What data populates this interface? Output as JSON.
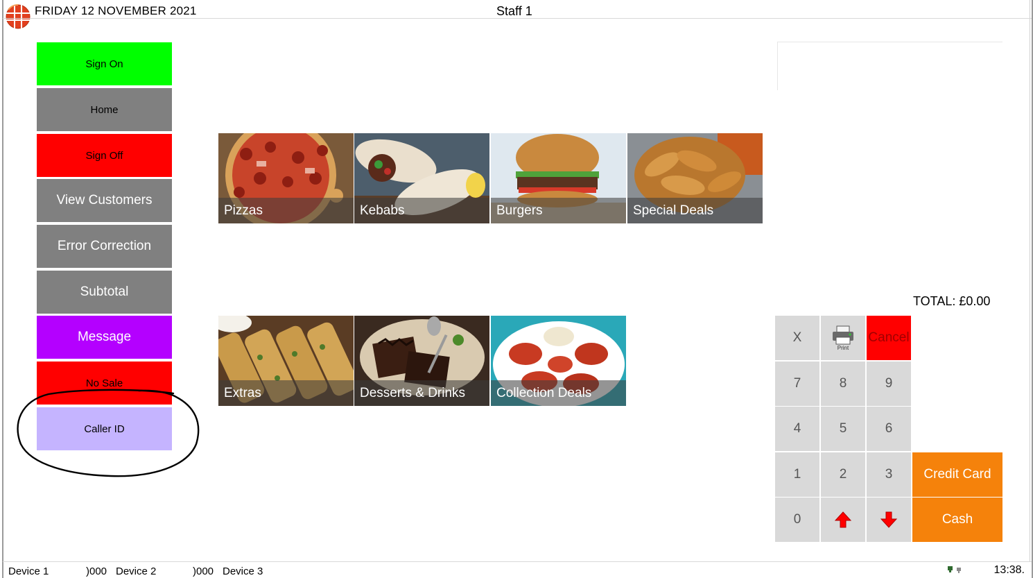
{
  "header": {
    "date": "FRIDAY 12 NOVEMBER 2021",
    "staff": "Staff 1"
  },
  "sidebar": {
    "items": [
      {
        "label": "Sign On",
        "color": "#00ff00",
        "text_color": "#000000"
      },
      {
        "label": "Home",
        "color": "#808080",
        "text_color": "#000000"
      },
      {
        "label": "Sign Off",
        "color": "#ff0000",
        "text_color": "#000000"
      },
      {
        "label": "View Customers",
        "color": "#808080",
        "text_color": "#ffffff"
      },
      {
        "label": "Error Correction",
        "color": "#808080",
        "text_color": "#ffffff"
      },
      {
        "label": "Subtotal",
        "color": "#808080",
        "text_color": "#ffffff"
      },
      {
        "label": "Message",
        "color": "#b400ff",
        "text_color": "#ffffff"
      },
      {
        "label": "No Sale",
        "color": "#ff0000",
        "text_color": "#000000"
      },
      {
        "label": "Caller ID",
        "color": "#c5b4ff",
        "text_color": "#000000"
      }
    ]
  },
  "categories": [
    {
      "label": "Pizzas",
      "image": "pizza-image"
    },
    {
      "label": "Kebabs",
      "image": "kebab-wrap-image"
    },
    {
      "label": "Burgers",
      "image": "burger-image"
    },
    {
      "label": "Special Deals",
      "image": "fried-chicken-image"
    },
    {
      "label": "Extras",
      "image": "garlic-bread-image"
    },
    {
      "label": "Desserts & Drinks",
      "image": "brownie-image"
    },
    {
      "label": "Collection Deals",
      "image": "chicken-wings-image"
    }
  ],
  "order": {
    "total": "TOTAL: £0.00"
  },
  "keypad": {
    "clear": "X",
    "print_label": "Print",
    "cancel": "Cancel",
    "digits": [
      "7",
      "8",
      "9",
      "4",
      "5",
      "6",
      "1",
      "2",
      "3",
      "0"
    ],
    "credit_card": "Credit Card",
    "cash": "Cash"
  },
  "statusbar": {
    "device1": "Device 1",
    "device1_value": ")000",
    "device2": "Device 2",
    "device2_value": ")000",
    "device3": "Device 3",
    "clock": "13:38."
  },
  "colors": {
    "accent_orange": "#f5820b",
    "cancel_red": "#ff0000",
    "keypad_gray": "#d9d9d9",
    "arrow_red": "#ff0000"
  }
}
